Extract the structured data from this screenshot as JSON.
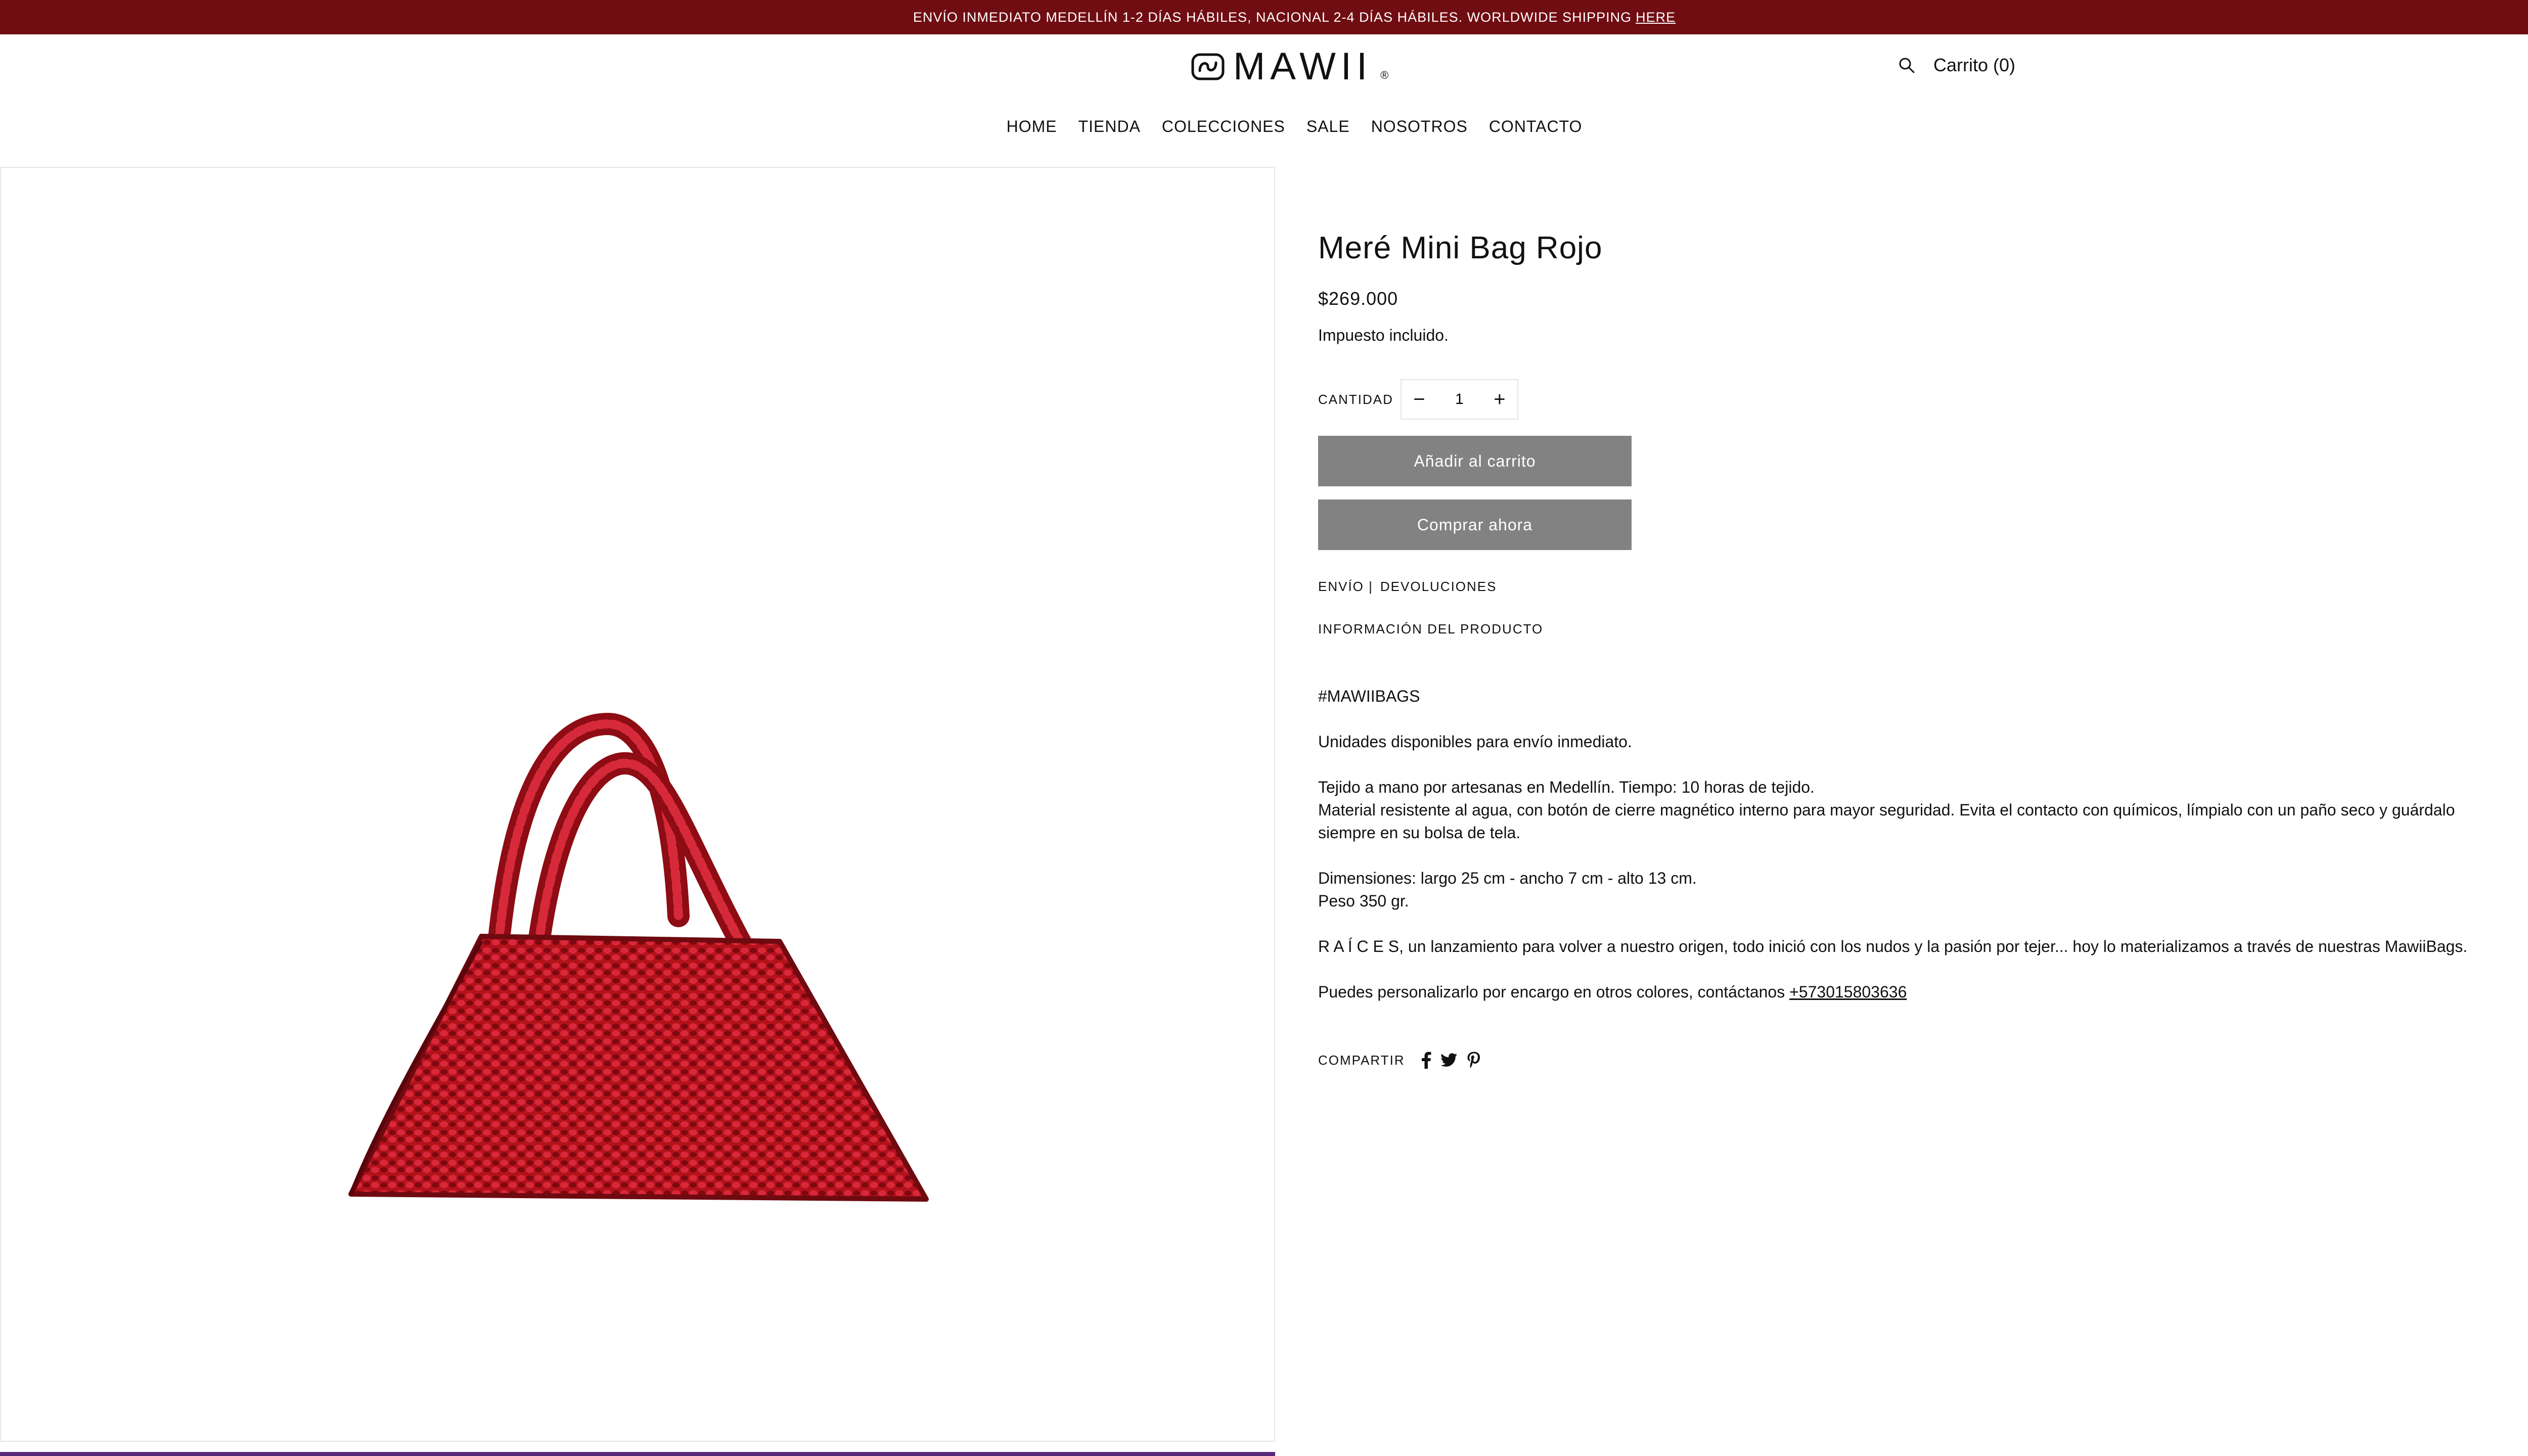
{
  "announcement": {
    "text": "ENVÍO INMEDIATO MEDELLÍN 1-2 DÍAS HÁBILES, NACIONAL 2-4 DÍAS HÁBILES. WORLDWIDE SHIPPING",
    "link_label": "HERE"
  },
  "header": {
    "logo_text": "MAWII",
    "logo_registered": "®",
    "cart_label": "Carrito (0)",
    "search_icon": "search-icon"
  },
  "nav": {
    "items": [
      "HOME",
      "TIENDA",
      "COLECCIONES",
      "SALE",
      "NOSOTROS",
      "CONTACTO"
    ]
  },
  "product": {
    "title": "Meré Mini Bag Rojo",
    "price": "$269.000",
    "tax_note": "Impuesto incluido.",
    "quantity_label": "CANTIDAD",
    "quantity_value": "1",
    "add_to_cart": "Añadir al carrito",
    "buy_now": "Comprar ahora",
    "shipping_link": "ENVÍO |",
    "returns_link": "DEVOLUCIONES",
    "info_link": "INFORMACIÓN DEL PRODUCTO",
    "accent_color": "#700d12",
    "button_color": "#828282"
  },
  "description": {
    "hashtag": "#MAWIIBAGS",
    "availability": "Unidades disponibles para envío inmediato.",
    "handmade": "Tejido a mano por artesanas en Medellín. Tiempo: 10 horas de tejido.",
    "material": "Material resistente al agua, con botón de cierre magnético interno para mayor seguridad. Evita el contacto con químicos, límpialo con un paño seco y guárdalo siempre en su bolsa de tela.",
    "dimensions": "Dimensiones: largo 25 cm - ancho 7 cm - alto 13 cm.",
    "weight": "Peso 350 gr.",
    "raices": "R A Í C E S, un lanzamiento para volver a nuestro origen, todo inició con los nudos y la pasión por tejer... hoy lo materializamos a través de nuestras MawiiBags.",
    "custom_text": "Puedes personalizarlo por encargo en otros colores, contáctanos",
    "phone": "+573015803636"
  },
  "share": {
    "label": "COMPARTIR",
    "icons": [
      "facebook-icon",
      "twitter-icon",
      "pinterest-icon"
    ]
  }
}
